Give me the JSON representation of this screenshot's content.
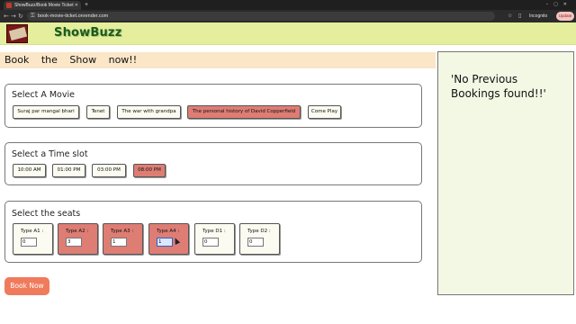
{
  "browser": {
    "tab_title": "ShowBuzz/Book Movie Ticket",
    "new_tab": "+",
    "url": "book-movie-ticket.onrender.com",
    "incognito_label": "Incognito",
    "update_label": "Update",
    "icons": [
      "back-icon",
      "forward-icon",
      "reload-icon",
      "lock-icon",
      "star-icon",
      "sidebar-icon",
      "profile-icon",
      "menu-icon"
    ]
  },
  "header": {
    "brand": "ShowBuzz"
  },
  "page": {
    "title": "Book the Show now!!"
  },
  "movies": {
    "title": "Select A Movie",
    "items": [
      {
        "label": "Suraj par mangal bhari",
        "selected": false
      },
      {
        "label": "Tenet",
        "selected": false
      },
      {
        "label": "The war with grandpa",
        "selected": false
      },
      {
        "label": "The personal history of David Copperfield",
        "selected": true
      },
      {
        "label": "Come Play",
        "selected": false
      }
    ]
  },
  "slots": {
    "title": "Select a Time slot",
    "items": [
      {
        "label": "10:00 AM",
        "selected": false
      },
      {
        "label": "01:00 PM",
        "selected": false
      },
      {
        "label": "03:00 PM",
        "selected": false
      },
      {
        "label": "08:00 PM",
        "selected": true
      }
    ]
  },
  "seats": {
    "title": "Select the seats",
    "items": [
      {
        "label": "Type A1 :",
        "value": "0",
        "selected": false
      },
      {
        "label": "Type A2 :",
        "value": "3",
        "selected": true
      },
      {
        "label": "Type A3 :",
        "value": "1",
        "selected": true
      },
      {
        "label": "Type A4 :",
        "value": "1",
        "selected": true
      },
      {
        "label": "Type D1 :",
        "value": "0",
        "selected": false
      },
      {
        "label": "Type D2 :",
        "value": "0",
        "selected": false
      }
    ]
  },
  "actions": {
    "book_now": "Book Now"
  },
  "bookings": {
    "message": "'No Previous Bookings found!!'"
  },
  "colors": {
    "header_bg": "#e4ee9c",
    "title_band": "#fbe6c8",
    "selected": "#de7d74",
    "book_button": "#f07a5c",
    "bookings_bg": "#f3f8e4"
  }
}
